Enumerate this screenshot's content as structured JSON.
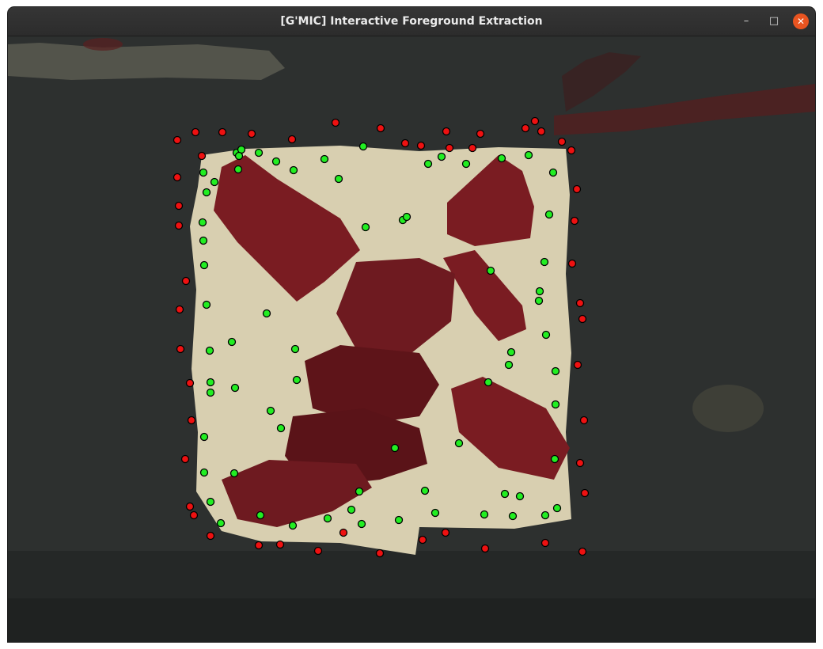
{
  "window": {
    "title": "[G'MIC] Interactive Foreground Extraction",
    "minimize_glyph": "–",
    "maximize_glyph": "□",
    "close_glyph": "✕"
  },
  "colors": {
    "background_marker": "#ee1111",
    "foreground_marker": "#22ee22",
    "titlebar": "#2f2f2f",
    "close_button": "#e95420"
  },
  "markers": {
    "background_count": 58,
    "foreground_count": 90
  }
}
